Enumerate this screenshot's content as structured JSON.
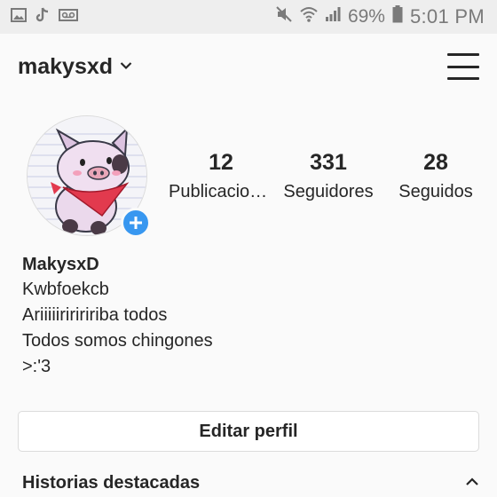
{
  "status_bar": {
    "battery_percent": "69%",
    "time": "5:01 PM",
    "left_icons": [
      "image-icon",
      "tiktok-icon",
      "voicemail-icon"
    ],
    "right_icons": [
      "mute-icon",
      "wifi-icon",
      "signal-icon",
      "battery-icon"
    ]
  },
  "header": {
    "username": "makysxd"
  },
  "profile": {
    "stats": [
      {
        "number": "12",
        "label": "Publicaciones"
      },
      {
        "number": "331",
        "label": "Seguidores"
      },
      {
        "number": "28",
        "label": "Seguidos"
      }
    ],
    "display_name": "MakysxD",
    "bio_lines": [
      "Kwbfoekcb",
      "Ariiiiiririririba todos",
      "Todos somos chingones",
      ">:'3"
    ]
  },
  "actions": {
    "edit_profile": "Editar perfil"
  },
  "highlights": {
    "title": "Historias destacadas"
  },
  "colors": {
    "accent_blue": "#3897f0",
    "bandana_red": "#e23a4e",
    "pig_pink": "#e9a6b8"
  }
}
